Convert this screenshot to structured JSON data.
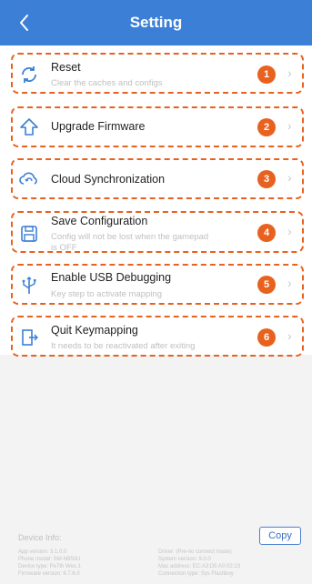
{
  "header": {
    "title": "Setting"
  },
  "items": [
    {
      "label": "Reset",
      "sub": "Clear the caches and configs",
      "badge": "1"
    },
    {
      "label": "Upgrade Firmware",
      "sub": "",
      "badge": "2"
    },
    {
      "label": "Cloud Synchronization",
      "sub": "",
      "badge": "3"
    },
    {
      "label": "Save Configuration",
      "sub": "Config will not be lost when the gamepad",
      "sub2": "is OFF",
      "badge": "4"
    },
    {
      "label": "Enable USB Debugging",
      "sub": "Key step to activate mapping",
      "badge": "5"
    },
    {
      "label": "Quit Keymapping",
      "sub": "It needs to be reactivated after exiting",
      "badge": "6"
    }
  ],
  "device": {
    "title": "Device Info:",
    "copy_label": "Copy",
    "left": [
      "App version: 3.1.0.0",
      "Phone model: SM-N950U",
      "Device type: Pe7th Wes.1",
      "Firmware version: 6.7.6.0"
    ],
    "right": [
      "Driver: (Pre-no connect mode)",
      "System version: 9.0.0",
      "Mac address: EC:A3:D5:A0:02:13",
      "Connection type: Sys Flashboy"
    ]
  }
}
